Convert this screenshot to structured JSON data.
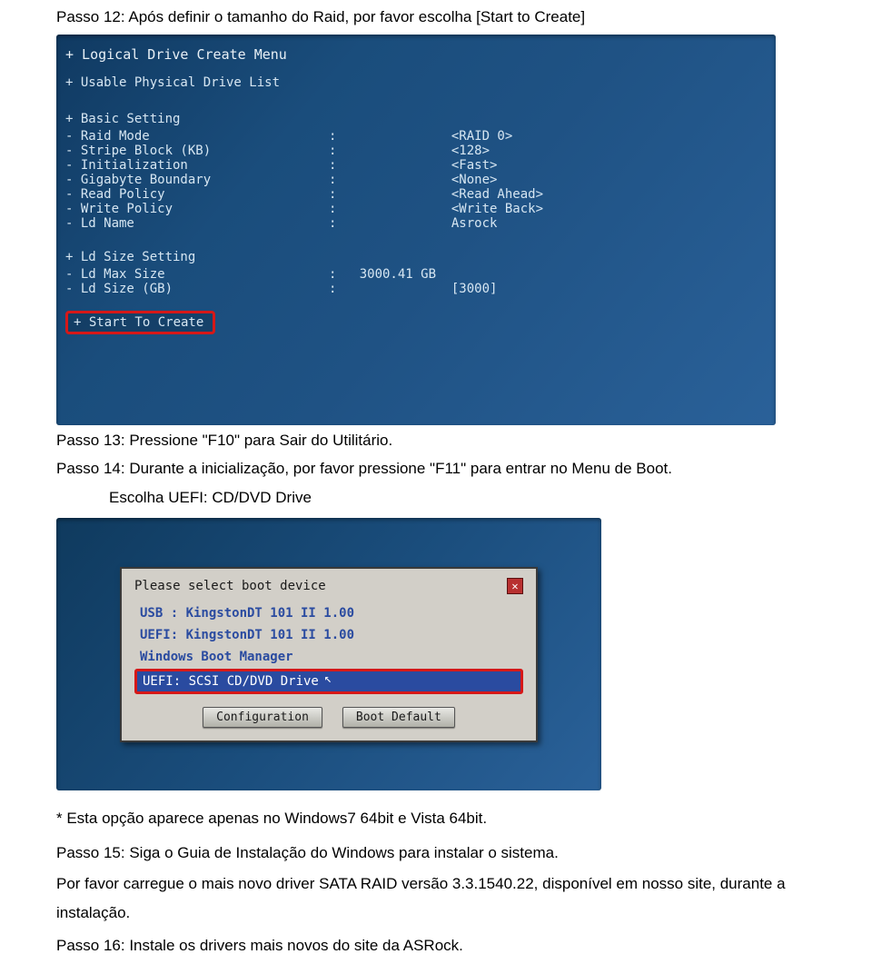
{
  "step12": "Passo 12: Após definir o tamanho do Raid, por favor escolha [Start to Create]",
  "bios": {
    "header": "+ Logical Drive Create Menu",
    "usable": "+ Usable Physical Drive List",
    "basic": "+ Basic Setting",
    "raidmode_lbl": "- Raid Mode",
    "stripe_lbl": "- Stripe Block (KB)",
    "init_lbl": "- Initialization",
    "gig_lbl": "- Gigabyte Boundary",
    "read_lbl": "- Read Policy",
    "write_lbl": "- Write Policy",
    "ldname_lbl": "- Ld Name",
    "raidmode_val": "<RAID 0>",
    "stripe_val": "<128>",
    "init_val": "<Fast>",
    "gig_val": "<None>",
    "read_val": "<Read Ahead>",
    "write_val": "<Write Back>",
    "ldname_val": "Asrock",
    "ldsize": "+ Ld Size Setting",
    "ldmax_lbl": "- Ld Max Size",
    "ldsize_lbl": "- Ld Size (GB)",
    "ldmax_val": "3000.41 GB",
    "ldsize_val": "[3000]",
    "start": "+ Start To Create"
  },
  "step13": "Passo 13: Pressione \"F10\" para Sair do Utilitário.",
  "step14": "Passo 14: Durante a inicialização, por favor pressione \"F11\" para entrar no Menu de Boot.",
  "step14b": "Escolha UEFI: CD/DVD Drive",
  "dialog": {
    "title": "Please select boot device",
    "item1": "USB : KingstonDT 101 II 1.00",
    "item2": "UEFI: KingstonDT 101 II 1.00",
    "item3": "Windows Boot Manager",
    "item4": "UEFI: SCSI CD/DVD Drive",
    "btn1": "Configuration",
    "btn2": "Boot Default"
  },
  "note": "* Esta opção aparece apenas no Windows7 64bit e Vista 64bit.",
  "step15": "Passo 15: Siga o Guia de Instalação do Windows para instalar o sistema.",
  "step15b": "Por favor carregue o mais novo driver SATA RAID versão 3.3.1540.22, disponível em nosso site, durante a instalação.",
  "step16": "Passo 16: Instale os drivers mais novos do site da ASRock."
}
